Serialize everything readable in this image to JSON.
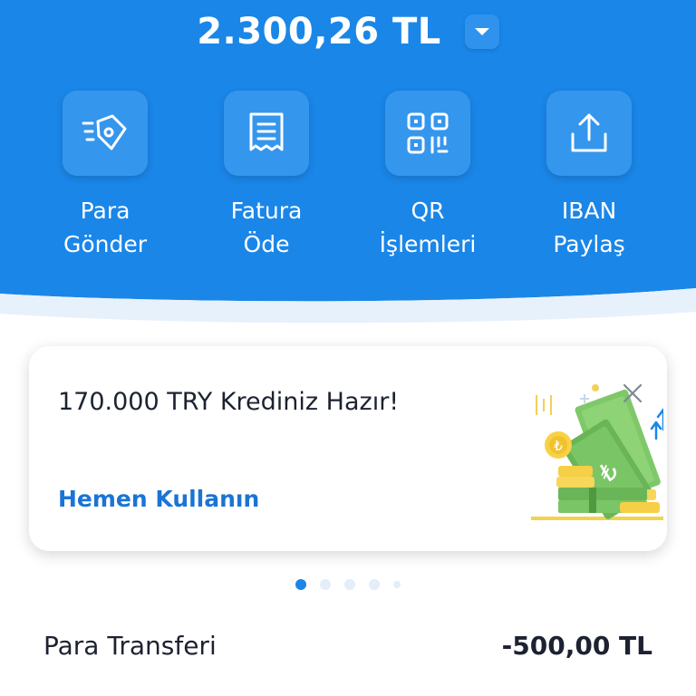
{
  "balance": {
    "amount": "2.300,26 TL"
  },
  "actions": [
    {
      "label_line1": "Para",
      "label_line2": "Gönder",
      "icon": "send-money-icon"
    },
    {
      "label_line1": "Fatura",
      "label_line2": "Öde",
      "icon": "receipt-icon"
    },
    {
      "label_line1": "QR",
      "label_line2": "İşlemleri",
      "icon": "qr-code-icon"
    },
    {
      "label_line1": "IBAN",
      "label_line2": "Paylaş",
      "icon": "share-icon"
    }
  ],
  "promo": {
    "title": "170.000 TRY Krediniz Hazır!",
    "cta": "Hemen Kullanın",
    "illustration": "money-illustration",
    "close_icon": "close-icon"
  },
  "carousel": {
    "total": 5,
    "active_index": 0
  },
  "transaction": {
    "title": "Para Transferi",
    "amount": "-500,00 TL"
  },
  "colors": {
    "header_blue": "#1a86e8",
    "link_blue": "#1a74d6",
    "text_dark": "#1c2230"
  }
}
